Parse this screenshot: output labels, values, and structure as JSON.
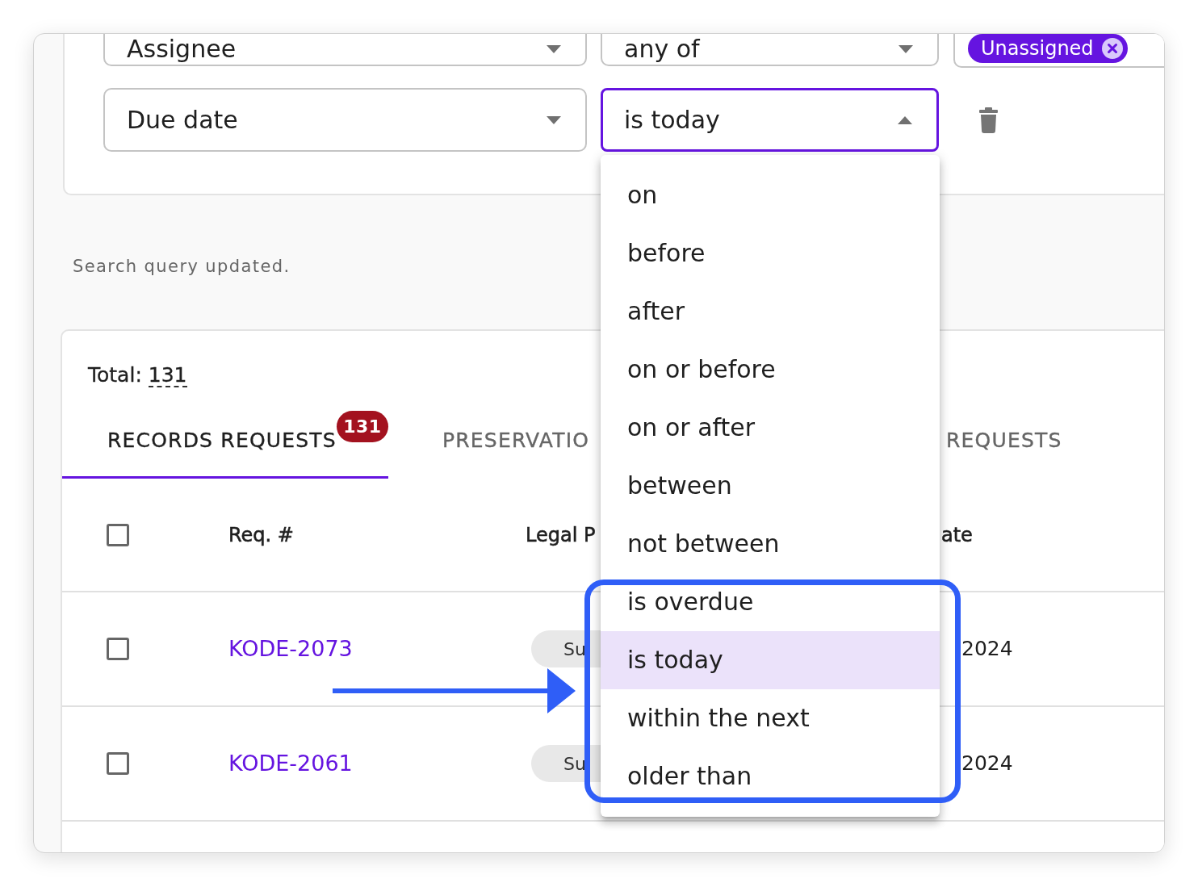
{
  "filters": [
    {
      "field": "Assignee",
      "operator": "any of",
      "operator_open": false,
      "values": [
        "Unassigned"
      ]
    },
    {
      "field": "Due date",
      "operator": "is today",
      "operator_open": true,
      "options": [
        {
          "label": "on",
          "selected": false
        },
        {
          "label": "before",
          "selected": false
        },
        {
          "label": "after",
          "selected": false
        },
        {
          "label": "on or before",
          "selected": false
        },
        {
          "label": "on or after",
          "selected": false
        },
        {
          "label": "between",
          "selected": false
        },
        {
          "label": "not between",
          "selected": false
        },
        {
          "label": "is overdue",
          "selected": false
        },
        {
          "label": "is today",
          "selected": true
        },
        {
          "label": "within the next",
          "selected": false
        },
        {
          "label": "older than",
          "selected": false
        }
      ]
    }
  ],
  "status_message": "Search query updated.",
  "results": {
    "total_label": "Total:",
    "total_value": "131",
    "tabs": [
      {
        "label": "RECORDS REQUESTS",
        "badge": "131",
        "selected": true
      },
      {
        "label": "PRESERVATIO",
        "selected": false
      },
      {
        "label": "REQUESTS",
        "selected": false
      }
    ],
    "table": {
      "header_checked": false,
      "columns": [
        {
          "label": "Req. #",
          "kind": "link"
        },
        {
          "label": "Legal P",
          "kind": "chip"
        },
        {
          "label": "ate",
          "kind": "text"
        }
      ],
      "rows": [
        {
          "checked": false,
          "cells": [
            "KODE-2073",
            "Su",
            "2024"
          ]
        },
        {
          "checked": false,
          "cells": [
            "KODE-2061",
            "Su",
            "2024"
          ]
        }
      ]
    }
  }
}
